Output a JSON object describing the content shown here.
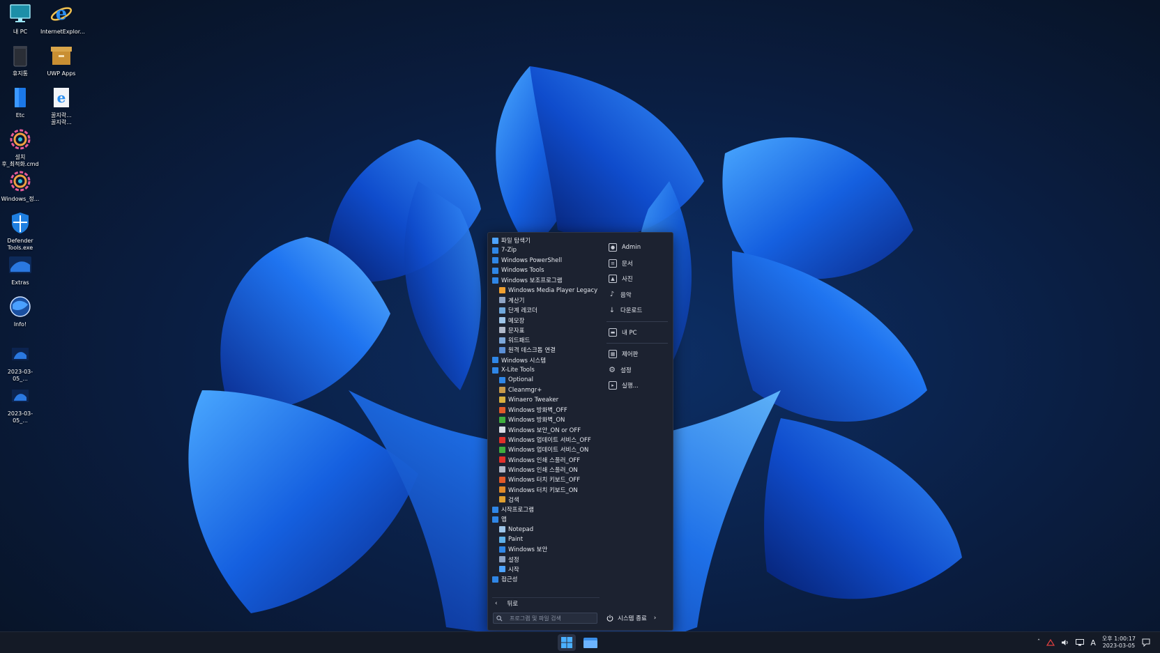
{
  "desktop": {
    "icons": [
      {
        "label": "내 PC",
        "icon": "monitor-icon"
      },
      {
        "label": "InternetExplor...",
        "icon": "internet-explorer-icon"
      },
      {
        "label": "휴지통",
        "icon": "recycle-bin-icon"
      },
      {
        "label": "UWP Apps",
        "icon": "archive-box-icon"
      },
      {
        "label": "Etc",
        "icon": "folder-blue-icon"
      },
      {
        "label": "꿀지락...\n꿀지락...",
        "icon": "ie-document-icon"
      },
      {
        "label": "설치\n후_최적화.cmd",
        "icon": "gear-icon"
      },
      {
        "label": "Windows_정...",
        "icon": "gear-icon"
      },
      {
        "label": "Defender\nTools.exe",
        "icon": "shield-icon"
      },
      {
        "label": "Extras",
        "icon": "wallpaper-thumb-icon"
      },
      {
        "label": "Info!",
        "icon": "globe-icon"
      },
      {
        "label": "2023-03-05_...",
        "icon": "screenshot-thumb-icon"
      },
      {
        "label": "2023-03-05_...",
        "icon": "screenshot-thumb-icon"
      }
    ]
  },
  "start_menu": {
    "programs": [
      {
        "label": "파일 탐색기",
        "level": 0,
        "color": "#4da3ff"
      },
      {
        "label": "7-Zip",
        "level": 0,
        "color": "#2f86e6"
      },
      {
        "label": "Windows PowerShell",
        "level": 0,
        "color": "#2f86e6"
      },
      {
        "label": "Windows Tools",
        "level": 0,
        "color": "#2f86e6"
      },
      {
        "label": "Windows 보조프로그램",
        "level": 0,
        "color": "#2f86e6"
      },
      {
        "label": "Windows Media Player Legacy",
        "level": 1,
        "color": "#f0a030"
      },
      {
        "label": "계산기",
        "level": 1,
        "color": "#8fa4c4"
      },
      {
        "label": "단계 레코더",
        "level": 1,
        "color": "#6fa8dc"
      },
      {
        "label": "메모장",
        "level": 1,
        "color": "#9ec5e8"
      },
      {
        "label": "문자표",
        "level": 1,
        "color": "#b0b8c8"
      },
      {
        "label": "워드패드",
        "level": 1,
        "color": "#7da7d9"
      },
      {
        "label": "원격 데스크톱 연결",
        "level": 1,
        "color": "#5b8fd6"
      },
      {
        "label": "Windows 시스템",
        "level": 0,
        "color": "#2f86e6"
      },
      {
        "label": "X-Lite Tools",
        "level": 0,
        "color": "#2f86e6"
      },
      {
        "label": "Optional",
        "level": 1,
        "color": "#2f86e6"
      },
      {
        "label": "Cleanmgr+",
        "level": 1,
        "color": "#c89a4a"
      },
      {
        "label": "Winaero Tweaker",
        "level": 1,
        "color": "#d8b040"
      },
      {
        "label": "Windows 방화벽_OFF",
        "level": 1,
        "color": "#e05a2a"
      },
      {
        "label": "Windows 방화벽_ON",
        "level": 1,
        "color": "#3fae3f"
      },
      {
        "label": "Windows 보안_ON or OFF",
        "level": 1,
        "color": "#d8dde6"
      },
      {
        "label": "Windows 업데이트 서비스_OFF",
        "level": 1,
        "color": "#e0302a"
      },
      {
        "label": "Windows 업데이트 서비스_ON",
        "level": 1,
        "color": "#3fae3f"
      },
      {
        "label": "Windows 인쇄 스풀러_OFF",
        "level": 1,
        "color": "#e0302a"
      },
      {
        "label": "Windows 인쇄 스풀러_ON",
        "level": 1,
        "color": "#b0b8c8"
      },
      {
        "label": "Windows 터치 키보드_OFF",
        "level": 1,
        "color": "#e05a2a"
      },
      {
        "label": "Windows 터치 키보드_ON",
        "level": 1,
        "color": "#e08a2a"
      },
      {
        "label": "검색",
        "level": 1,
        "color": "#e0a030"
      },
      {
        "label": "시작프로그램",
        "level": 0,
        "color": "#2f86e6"
      },
      {
        "label": "앱",
        "level": 0,
        "color": "#2f86e6"
      },
      {
        "label": "Notepad",
        "level": 1,
        "color": "#9ec5e8"
      },
      {
        "label": "Paint",
        "level": 1,
        "color": "#5fb0e8"
      },
      {
        "label": "Windows 보안",
        "level": 1,
        "color": "#2f86e6"
      },
      {
        "label": "설정",
        "level": 1,
        "color": "#8fa4c4"
      },
      {
        "label": "시작",
        "level": 1,
        "color": "#4da3ff"
      },
      {
        "label": "접근성",
        "level": 0,
        "color": "#2f86e6"
      }
    ],
    "places": [
      {
        "label": "Admin",
        "icon": "user-icon"
      },
      {
        "label": "문서",
        "icon": "document-icon"
      },
      {
        "label": "사진",
        "icon": "picture-icon"
      },
      {
        "label": "음악",
        "icon": "music-icon"
      },
      {
        "label": "다운로드",
        "icon": "download-icon"
      },
      {
        "label": "내 PC",
        "icon": "computer-icon"
      },
      {
        "label": "제어판",
        "icon": "control-panel-icon"
      },
      {
        "label": "설정",
        "icon": "gear-icon"
      },
      {
        "label": "실행...",
        "icon": "run-icon"
      }
    ],
    "back_label": "뒤로",
    "search_placeholder": "프로그램 및 파일 검색",
    "shutdown_label": "시스템 종료"
  },
  "taskbar": {
    "tray_language": "A",
    "clock_time": "오후 1:00:17",
    "clock_date": "2023-03-05"
  },
  "colors": {
    "accent": "#2f86e6",
    "menu_bg": "#1c2230",
    "taskbar_bg": "#141a26"
  }
}
